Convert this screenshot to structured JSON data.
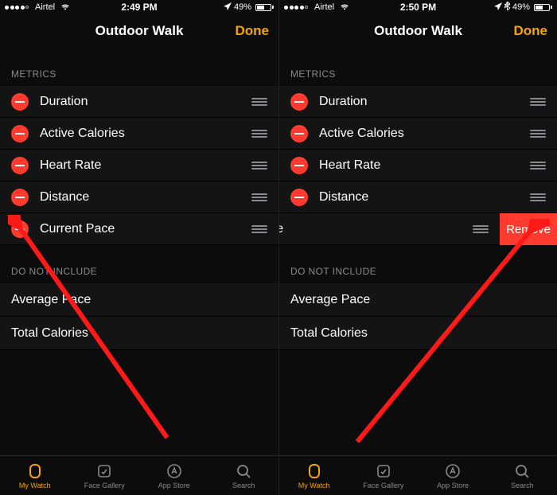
{
  "left": {
    "status": {
      "carrier": "Airtel",
      "time": "2:49 PM",
      "battery_pct": "49%"
    },
    "header": {
      "title": "Outdoor Walk",
      "done": "Done"
    },
    "metrics_header": "METRICS",
    "metrics": [
      {
        "label": "Duration"
      },
      {
        "label": "Active Calories"
      },
      {
        "label": "Heart Rate"
      },
      {
        "label": "Distance"
      },
      {
        "label": "Current Pace"
      }
    ],
    "exclude_header": "DO NOT INCLUDE",
    "excluded": [
      {
        "label": "Average Pace"
      },
      {
        "label": "Total Calories"
      }
    ],
    "tabs": [
      {
        "label": "My Watch",
        "active": true
      },
      {
        "label": "Face Gallery",
        "active": false
      },
      {
        "label": "App Store",
        "active": false
      },
      {
        "label": "Search",
        "active": false
      }
    ]
  },
  "right": {
    "status": {
      "carrier": "Airtel",
      "time": "2:50 PM",
      "battery_pct": "49%"
    },
    "header": {
      "title": "Outdoor Walk",
      "done": "Done"
    },
    "metrics_header": "METRICS",
    "metrics": [
      {
        "label": "Duration"
      },
      {
        "label": "Active Calories"
      },
      {
        "label": "Heart Rate"
      },
      {
        "label": "Distance"
      },
      {
        "label": "ent Pace",
        "remove": "Remove"
      }
    ],
    "exclude_header": "DO NOT INCLUDE",
    "excluded": [
      {
        "label": "Average Pace"
      },
      {
        "label": "Total Calories"
      }
    ],
    "tabs": [
      {
        "label": "My Watch",
        "active": true
      },
      {
        "label": "Face Gallery",
        "active": false
      },
      {
        "label": "App Store",
        "active": false
      },
      {
        "label": "Search",
        "active": false
      }
    ]
  }
}
